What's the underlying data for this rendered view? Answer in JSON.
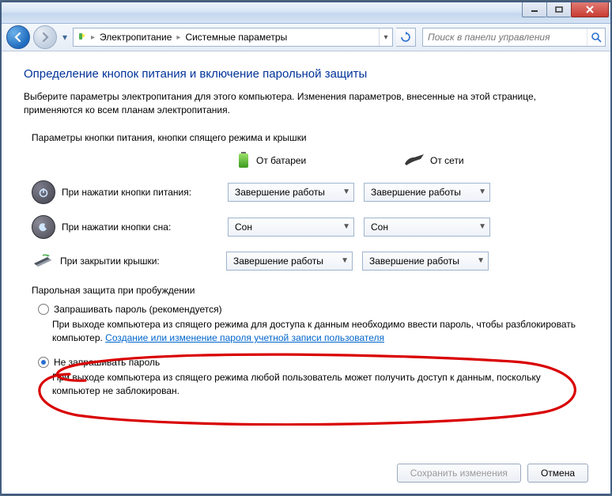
{
  "breadcrumb": {
    "item1": "Электропитание",
    "item2": "Системные параметры"
  },
  "search": {
    "placeholder": "Поиск в панели управления"
  },
  "heading": "Определение кнопок питания и включение парольной защиты",
  "intro": "Выберите параметры электропитания для этого компьютера. Изменения параметров, внесенные на этой странице, применяются ко всем планам электропитания.",
  "sections": {
    "buttons_label": "Параметры кнопки питания, кнопки спящего режима и крышки",
    "wake_label": "Парольная защита при пробуждении"
  },
  "columns": {
    "battery": "От батареи",
    "ac": "От сети"
  },
  "rows": {
    "power": {
      "label": "При нажатии кнопки питания:",
      "battery": "Завершение работы",
      "ac": "Завершение работы"
    },
    "sleep": {
      "label": "При нажатии кнопки сна:",
      "battery": "Сон",
      "ac": "Сон"
    },
    "lid": {
      "label": "При закрытии крышки:",
      "battery": "Завершение работы",
      "ac": "Завершение работы"
    }
  },
  "radios": {
    "require": {
      "label": "Запрашивать пароль (рекомендуется)",
      "desc": "При выходе компьютера из спящего режима для доступа к данным необходимо ввести пароль, чтобы разблокировать компьютер. ",
      "link": "Создание или изменение пароля учетной записи пользователя"
    },
    "norequire": {
      "label": "Не запрашивать пароль",
      "desc": "При выходе компьютера из спящего режима любой пользователь может получить доступ к данным, поскольку компьютер не заблокирован."
    }
  },
  "footer": {
    "save": "Сохранить изменения",
    "cancel": "Отмена"
  }
}
